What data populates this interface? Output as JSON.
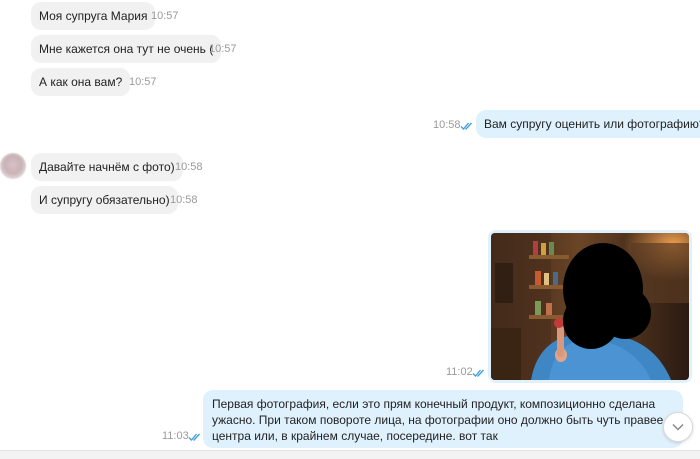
{
  "messages": [
    {
      "text": "Моя супруга Мария",
      "time": "10:57"
    },
    {
      "text": "Мне кажется она тут не очень (",
      "time": "10:57"
    },
    {
      "text": "А как она вам?",
      "time": "10:57"
    },
    {
      "text": "Вам супругу оценить или фотографию?)",
      "time": "10:58"
    },
    {
      "text": "Давайте начнём с фото)",
      "time": "10:58"
    },
    {
      "text": "И супругу обязательно)",
      "time": "10:58"
    },
    {
      "text": "",
      "time": "11:02"
    },
    {
      "text": "Первая фотография, если это прям конечный продукт, композиционно сделана ужасно. При таком повороте лица, на фотографии оно должно быть чуть правее центра или, в крайнем случае, посередине. вот так",
      "time": "11:03"
    }
  ],
  "icons": {
    "read_receipt": "double-check-icon",
    "scroll_down": "chevron-down-icon",
    "avatar": "avatar"
  },
  "colors": {
    "incoming_bubble": "#f1f1f1",
    "outgoing_bubble": "#dff1fd",
    "time_text": "#9a9a9a",
    "check_color": "#3d9be0"
  }
}
